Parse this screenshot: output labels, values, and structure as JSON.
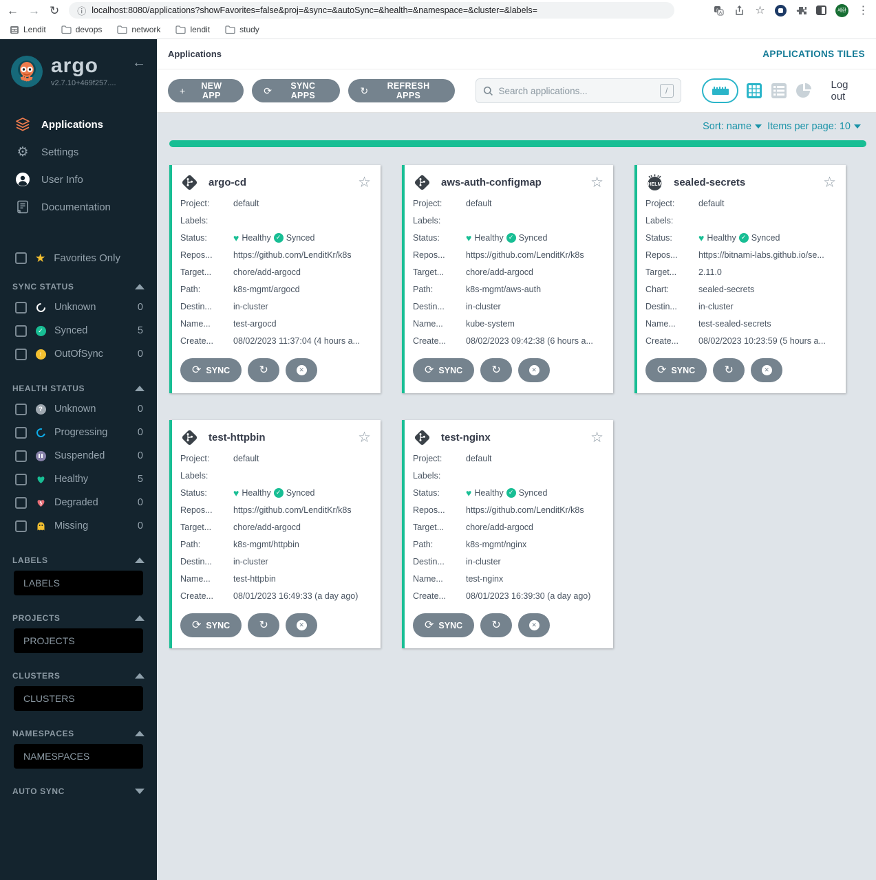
{
  "browser": {
    "url": "localhost:8080/applications?showFavorites=false&proj=&sync=&autoSync=&health=&namespace=&cluster=&labels=",
    "back": "←",
    "forward": "→",
    "reload": "↻",
    "info": "ⓘ",
    "star": "☆",
    "kebab": "⋮",
    "share": "↑",
    "avatar_text": "세환",
    "bookmarks": [
      {
        "label": "Lendit"
      },
      {
        "label": "devops"
      },
      {
        "label": "network"
      },
      {
        "label": "lendit"
      },
      {
        "label": "study"
      }
    ]
  },
  "sidebar": {
    "logo_word": "argo",
    "version": "v2.7.10+469f257....",
    "collapse_arrow": "←",
    "nav": [
      {
        "label": "Applications"
      },
      {
        "label": "Settings"
      },
      {
        "label": "User Info"
      },
      {
        "label": "Documentation"
      }
    ],
    "favorites_label": "Favorites Only",
    "favorites_star": "★",
    "gear_glyph": "⚙",
    "sync_status": {
      "title": "SYNC STATUS",
      "items": [
        {
          "label": "Unknown",
          "count": "0"
        },
        {
          "label": "Synced",
          "count": "5"
        },
        {
          "label": "OutOfSync",
          "count": "0"
        }
      ]
    },
    "health_status": {
      "title": "HEALTH STATUS",
      "items": [
        {
          "label": "Unknown",
          "count": "0"
        },
        {
          "label": "Progressing",
          "count": "0"
        },
        {
          "label": "Suspended",
          "count": "0"
        },
        {
          "label": "Healthy",
          "count": "5"
        },
        {
          "label": "Degraded",
          "count": "0"
        },
        {
          "label": "Missing",
          "count": "0"
        }
      ]
    },
    "filters": {
      "labels": {
        "title": "LABELS",
        "placeholder": "LABELS"
      },
      "projects": {
        "title": "PROJECTS",
        "placeholder": "PROJECTS"
      },
      "clusters": {
        "title": "CLUSTERS",
        "placeholder": "CLUSTERS"
      },
      "namespaces": {
        "title": "NAMESPACES",
        "placeholder": "NAMESPACES"
      }
    },
    "auto_sync_title": "AUTO SYNC"
  },
  "header": {
    "breadcrumb": "Applications",
    "view_title": "APPLICATIONS TILES"
  },
  "toolbar": {
    "new_app": "NEW APP",
    "sync_apps": "SYNC APPS",
    "refresh_apps": "REFRESH APPS",
    "plus": "+",
    "sync_glyph": "⟳",
    "refresh_glyph": "↻",
    "search_placeholder": "Search applications...",
    "shortcut_key": "/",
    "logout": "Log out"
  },
  "sortbar": {
    "sort": "Sort: name",
    "items_per_page": "Items per page: 10"
  },
  "field_labels": {
    "project": "Project:",
    "labels": "Labels:",
    "status": "Status:",
    "repos": "Repos...",
    "target": "Target...",
    "destination": "Destin...",
    "name": "Name...",
    "created": "Create..."
  },
  "status_words": {
    "healthy": "Healthy",
    "synced": "Synced",
    "check": "✓"
  },
  "card_buttons": {
    "sync": "SYNC",
    "sync_glyph": "⟳",
    "refresh_glyph": "↻",
    "x": "✕",
    "star": "☆"
  },
  "cards": [
    {
      "name": "argo-cd",
      "icon": "git",
      "project": "default",
      "labels": "",
      "repo": "https://github.com/LenditKr/k8s",
      "target": "chore/add-argocd",
      "path_label": "Path:",
      "path": "k8s-mgmt/argocd",
      "destination": "in-cluster",
      "namespace": "test-argocd",
      "created": "08/02/2023 11:37:04  (4 hours a..."
    },
    {
      "name": "aws-auth-configmap",
      "icon": "git",
      "project": "default",
      "labels": "",
      "repo": "https://github.com/LenditKr/k8s",
      "target": "chore/add-argocd",
      "path_label": "Path:",
      "path": "k8s-mgmt/aws-auth",
      "destination": "in-cluster",
      "namespace": "kube-system",
      "created": "08/02/2023 09:42:38  (6 hours a..."
    },
    {
      "name": "sealed-secrets",
      "icon": "helm",
      "project": "default",
      "labels": "",
      "repo": "https://bitnami-labs.github.io/se...",
      "target": "2.11.0",
      "path_label": "Chart:",
      "path": "sealed-secrets",
      "destination": "in-cluster",
      "namespace": "test-sealed-secrets",
      "created": "08/02/2023 10:23:59  (5 hours a..."
    },
    {
      "name": "test-httpbin",
      "icon": "git",
      "project": "default",
      "labels": "",
      "repo": "https://github.com/LenditKr/k8s",
      "target": "chore/add-argocd",
      "path_label": "Path:",
      "path": "k8s-mgmt/httpbin",
      "destination": "in-cluster",
      "namespace": "test-httpbin",
      "created": "08/01/2023 16:49:33  (a day ago)"
    },
    {
      "name": "test-nginx",
      "icon": "git",
      "project": "default",
      "labels": "",
      "repo": "https://github.com/LenditKr/k8s",
      "target": "chore/add-argocd",
      "path_label": "Path:",
      "path": "k8s-mgmt/nginx",
      "destination": "in-cluster",
      "namespace": "test-nginx",
      "created": "08/01/2023 16:39:30  (a day ago)"
    }
  ],
  "colors": {
    "sidebar_bg": "#14242e",
    "accent_teal": "#1a93a8",
    "success_green": "#18be94",
    "warning_yellow": "#f4c030",
    "danger_red": "#e96d76",
    "progressing_blue": "#0dadea",
    "suspended_purple": "#8781a9",
    "button_gray": "#75838e",
    "argo_orange": "#e96e38"
  }
}
